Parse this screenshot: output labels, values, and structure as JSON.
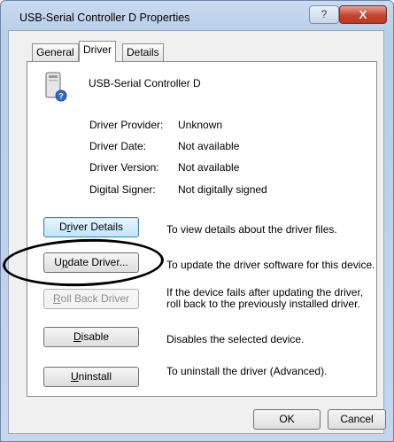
{
  "window": {
    "title": "USB-Serial Controller D Properties"
  },
  "titlebar": {
    "help_label": "?",
    "close_label": "X"
  },
  "tabs": [
    {
      "label": "General"
    },
    {
      "label": "Driver"
    },
    {
      "label": "Details"
    }
  ],
  "device": {
    "name": "USB-Serial Controller D",
    "icon": "device-icon"
  },
  "info": [
    {
      "label": "Driver Provider:",
      "value": "Unknown"
    },
    {
      "label": "Driver Date:",
      "value": "Not available"
    },
    {
      "label": "Driver Version:",
      "value": "Not available"
    },
    {
      "label": "Digital Signer:",
      "value": "Not digitally signed"
    }
  ],
  "actions": {
    "details": {
      "pre": "D",
      "accel": "r",
      "post": "iver Details",
      "desc": "To view details about the driver files."
    },
    "update": {
      "pre": "U",
      "accel": "p",
      "post": "date Driver...",
      "desc": "To update the driver software for this device."
    },
    "rollback": {
      "pre": "",
      "accel": "R",
      "post": "oll Back Driver",
      "desc": "If the device fails after updating the driver, roll back to the previously installed driver."
    },
    "disable": {
      "pre": "",
      "accel": "D",
      "post": "isable",
      "desc": "Disables the selected device."
    },
    "uninstall": {
      "pre": "",
      "accel": "U",
      "post": "ninstall",
      "desc": "To uninstall the driver (Advanced)."
    }
  },
  "footer": {
    "ok_label": "OK",
    "cancel_label": "Cancel"
  },
  "annotation": {
    "shape": "hand-drawn ellipse",
    "color": "#000000"
  }
}
